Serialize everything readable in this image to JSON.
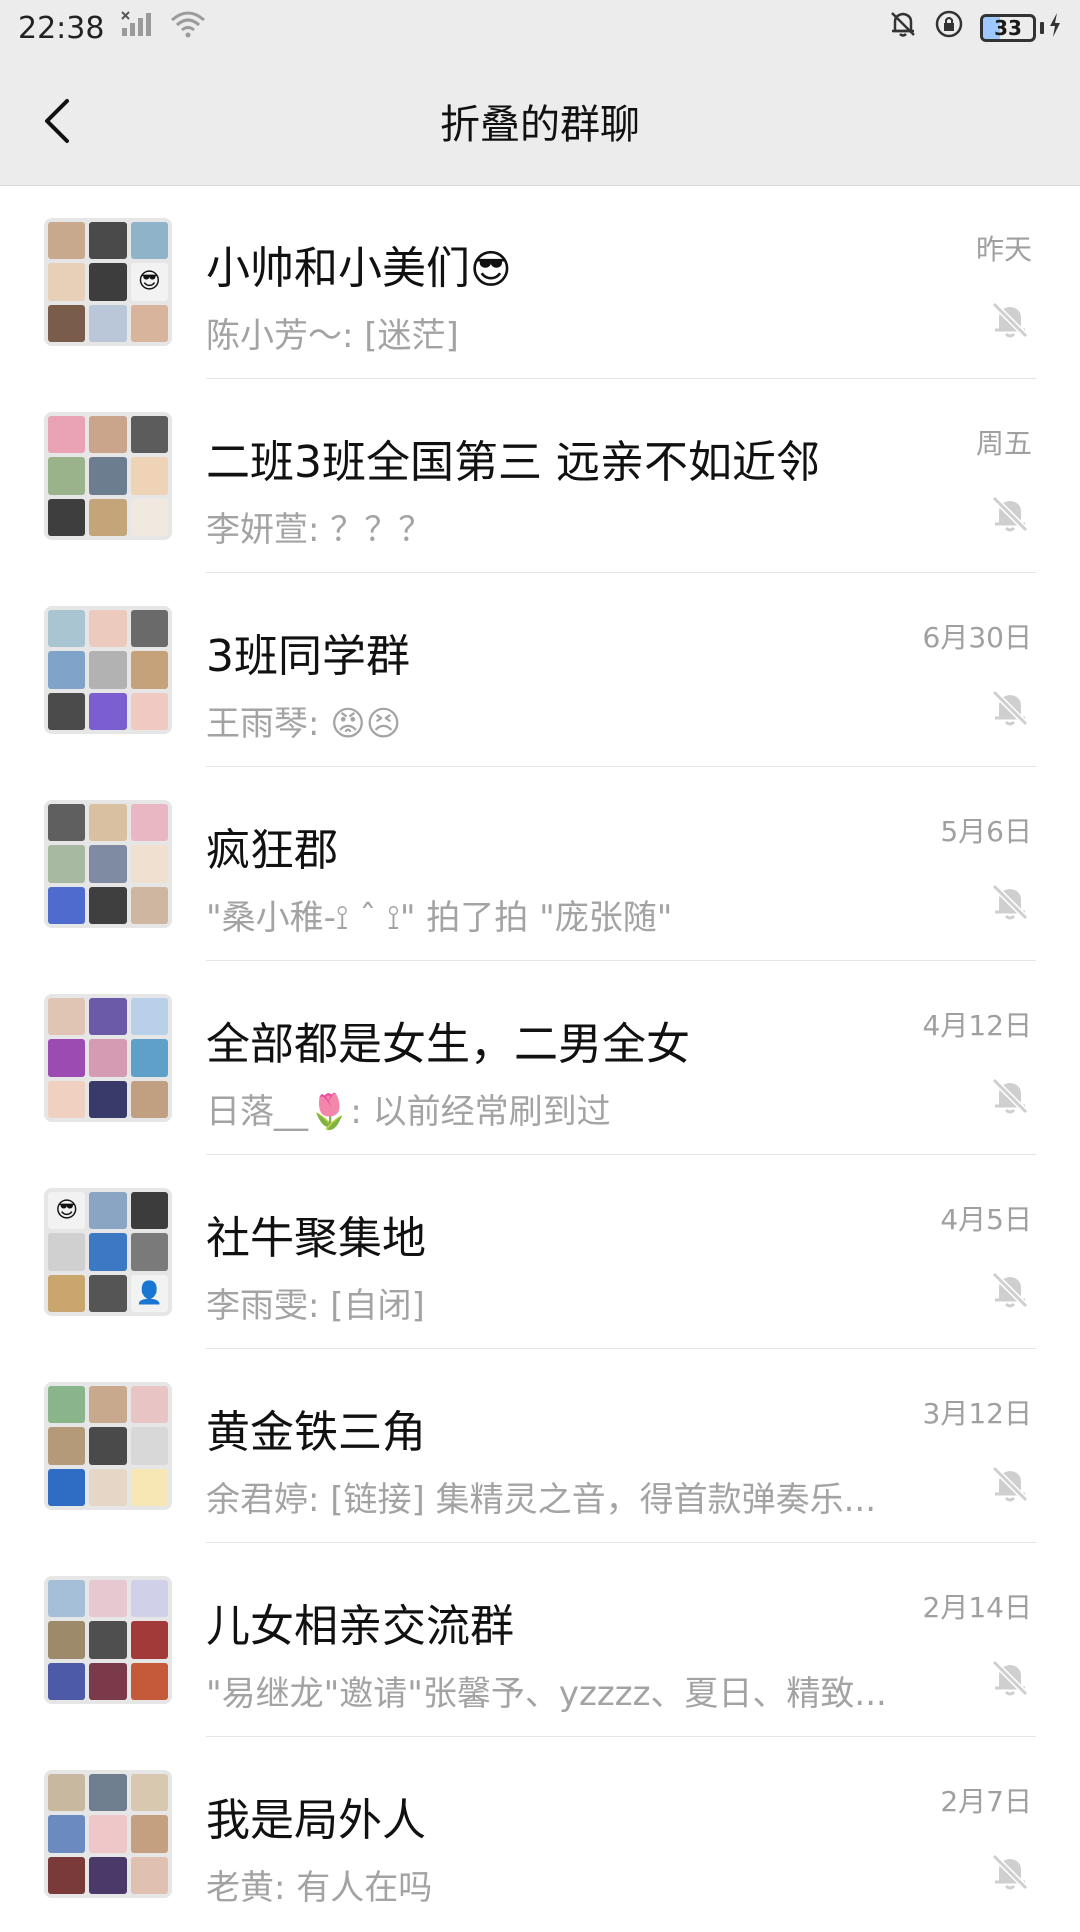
{
  "status": {
    "time": "22:38",
    "battery": "33",
    "battery_level": 0.33
  },
  "header": {
    "title": "折叠的群聊"
  },
  "colors": {
    "header_bg": "#ececec",
    "secondary_text": "#a3a3a3",
    "divider": "#e5e5e5"
  },
  "groups": [
    {
      "name": "小帅和小美们",
      "name_emoji": "😎",
      "message": "陈小芳～: [迷茫]",
      "time": "昨天",
      "muted": true
    },
    {
      "name": "二班3班全国第三 远亲不如近邻",
      "name_emoji": "",
      "message": "李妍萱: ？？？",
      "time": "周五",
      "muted": true
    },
    {
      "name": "3班同学群",
      "name_emoji": "",
      "message": "王雨琴: 😡😣",
      "time": "6月30日",
      "muted": true
    },
    {
      "name": "疯狂郡",
      "name_emoji": "",
      "message": "\"桑小稚-⟟ ˆ ⟟\" 拍了拍 \"庞张随\"",
      "time": "5月6日",
      "muted": true
    },
    {
      "name": "全部都是女生，二男全女",
      "name_emoji": "",
      "message": "日落__🌷: 以前经常刷到过",
      "time": "4月12日",
      "muted": true
    },
    {
      "name": "社牛聚集地",
      "name_emoji": "",
      "message": "李雨雯: [自闭]",
      "time": "4月5日",
      "muted": true
    },
    {
      "name": "黄金铁三角",
      "name_emoji": "",
      "message": "余君婷: [链接] 集精灵之音，得首款弹奏乐...",
      "time": "3月12日",
      "muted": true
    },
    {
      "name": "儿女相亲交流群",
      "name_emoji": "",
      "message": "\"易继龙\"邀请\"张馨予、yzzzz、夏日、精致...",
      "time": "2月14日",
      "muted": true
    },
    {
      "name": "我是局外人",
      "name_emoji": "",
      "message": "老黄: 有人在吗",
      "time": "2月7日",
      "muted": true
    }
  ]
}
